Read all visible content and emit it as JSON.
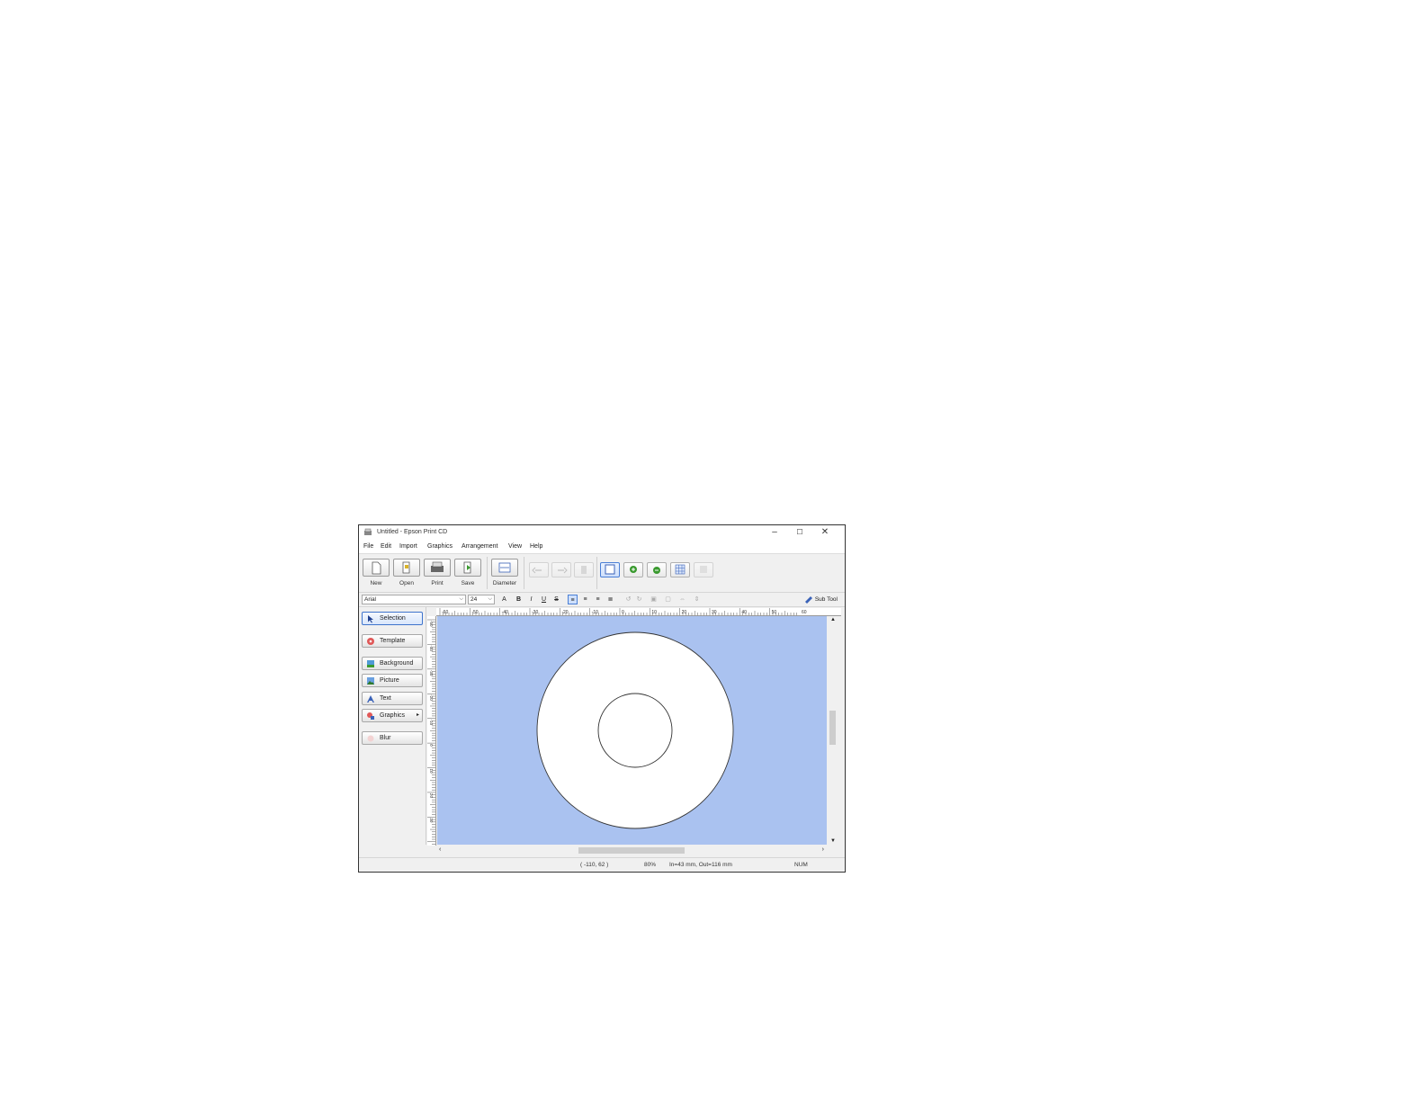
{
  "window": {
    "title": "Untitled - Epson Print CD",
    "controls": {
      "minimize": "–",
      "maximize": "☐",
      "close": "✕"
    }
  },
  "menubar": {
    "items": [
      {
        "label": "File"
      },
      {
        "label": "Edit"
      },
      {
        "label": "Import"
      },
      {
        "label": "Graphics"
      },
      {
        "label": "Arrangement"
      },
      {
        "label": "View"
      },
      {
        "label": "Help"
      }
    ]
  },
  "toolbar": {
    "buttons": [
      {
        "label": "New",
        "icon": "new-document-icon"
      },
      {
        "label": "Open",
        "icon": "open-folder-icon"
      },
      {
        "label": "Print",
        "icon": "printer-icon"
      },
      {
        "label": "Save",
        "icon": "save-icon"
      },
      {
        "label": "Diameter",
        "icon": "diameter-icon"
      }
    ],
    "small_buttons": [
      {
        "icon": "undo-icon",
        "enabled": false
      },
      {
        "icon": "redo-icon",
        "enabled": false
      },
      {
        "icon": "delete-icon",
        "enabled": false
      },
      {
        "icon": "fit-page-icon",
        "enabled": true,
        "active": true
      },
      {
        "icon": "zoom-in-icon",
        "enabled": true
      },
      {
        "icon": "zoom-out-icon",
        "enabled": true
      },
      {
        "icon": "grid-icon",
        "enabled": true
      },
      {
        "icon": "layer-icon",
        "enabled": false
      }
    ]
  },
  "format_bar": {
    "font": "Arial",
    "size": "24",
    "sub_tool_label": "Sub Tool"
  },
  "sidebar": {
    "buttons": [
      {
        "label": "Selection",
        "icon": "arrow-cursor-icon",
        "selected": true
      },
      {
        "label": "Template",
        "icon": "template-icon"
      },
      {
        "label": "Background",
        "icon": "background-icon"
      },
      {
        "label": "Picture",
        "icon": "picture-icon"
      },
      {
        "label": "Text",
        "icon": "text-icon"
      },
      {
        "label": "Graphics",
        "icon": "shapes-icon",
        "has_submenu": true
      },
      {
        "label": "Blur",
        "icon": "blur-icon",
        "enabled": false
      }
    ]
  },
  "ruler": {
    "h_labels": [
      "-60",
      "-50",
      "-40",
      "-30",
      "-20",
      "-10",
      "0",
      "10",
      "20",
      "30",
      "40",
      "50",
      "60"
    ],
    "v_labels": [
      "-50",
      "-40",
      "-30",
      "-20",
      "-10",
      "0",
      "10",
      "20",
      "30"
    ]
  },
  "canvas": {
    "background_color": "#aac2f0",
    "disc_color": "#ffffff",
    "outline_color": "#333333",
    "outer_diameter_mm": 116,
    "inner_diameter_mm": 43
  },
  "statusbar": {
    "coords": "( -110,  62 )",
    "zoom": "80%",
    "disc_info": "In=43 mm, Out=116 mm",
    "num": "NUM"
  }
}
